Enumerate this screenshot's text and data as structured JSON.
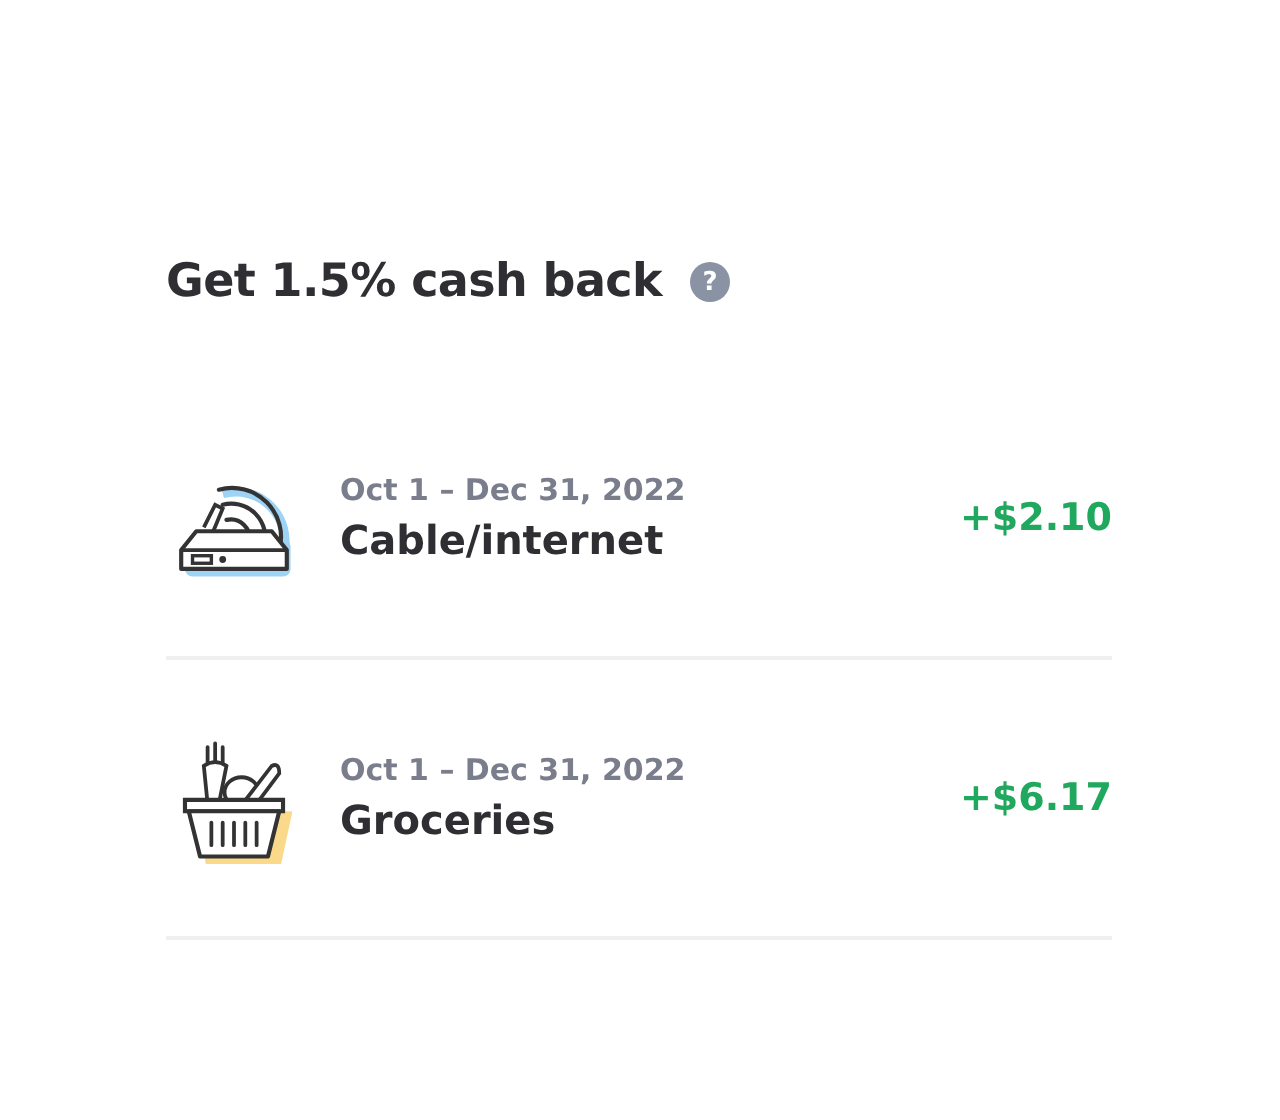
{
  "title": "Get 1.5% cash back",
  "help_icon": "?",
  "offers": [
    {
      "kind": "router",
      "period": "Oct 1 – Dec 31, 2022",
      "category": "Cable/internet",
      "amount": "+$2.10"
    },
    {
      "kind": "basket",
      "period": "Oct 1 – Dec 31, 2022",
      "category": "Groceries",
      "amount": "+$6.17"
    }
  ]
}
